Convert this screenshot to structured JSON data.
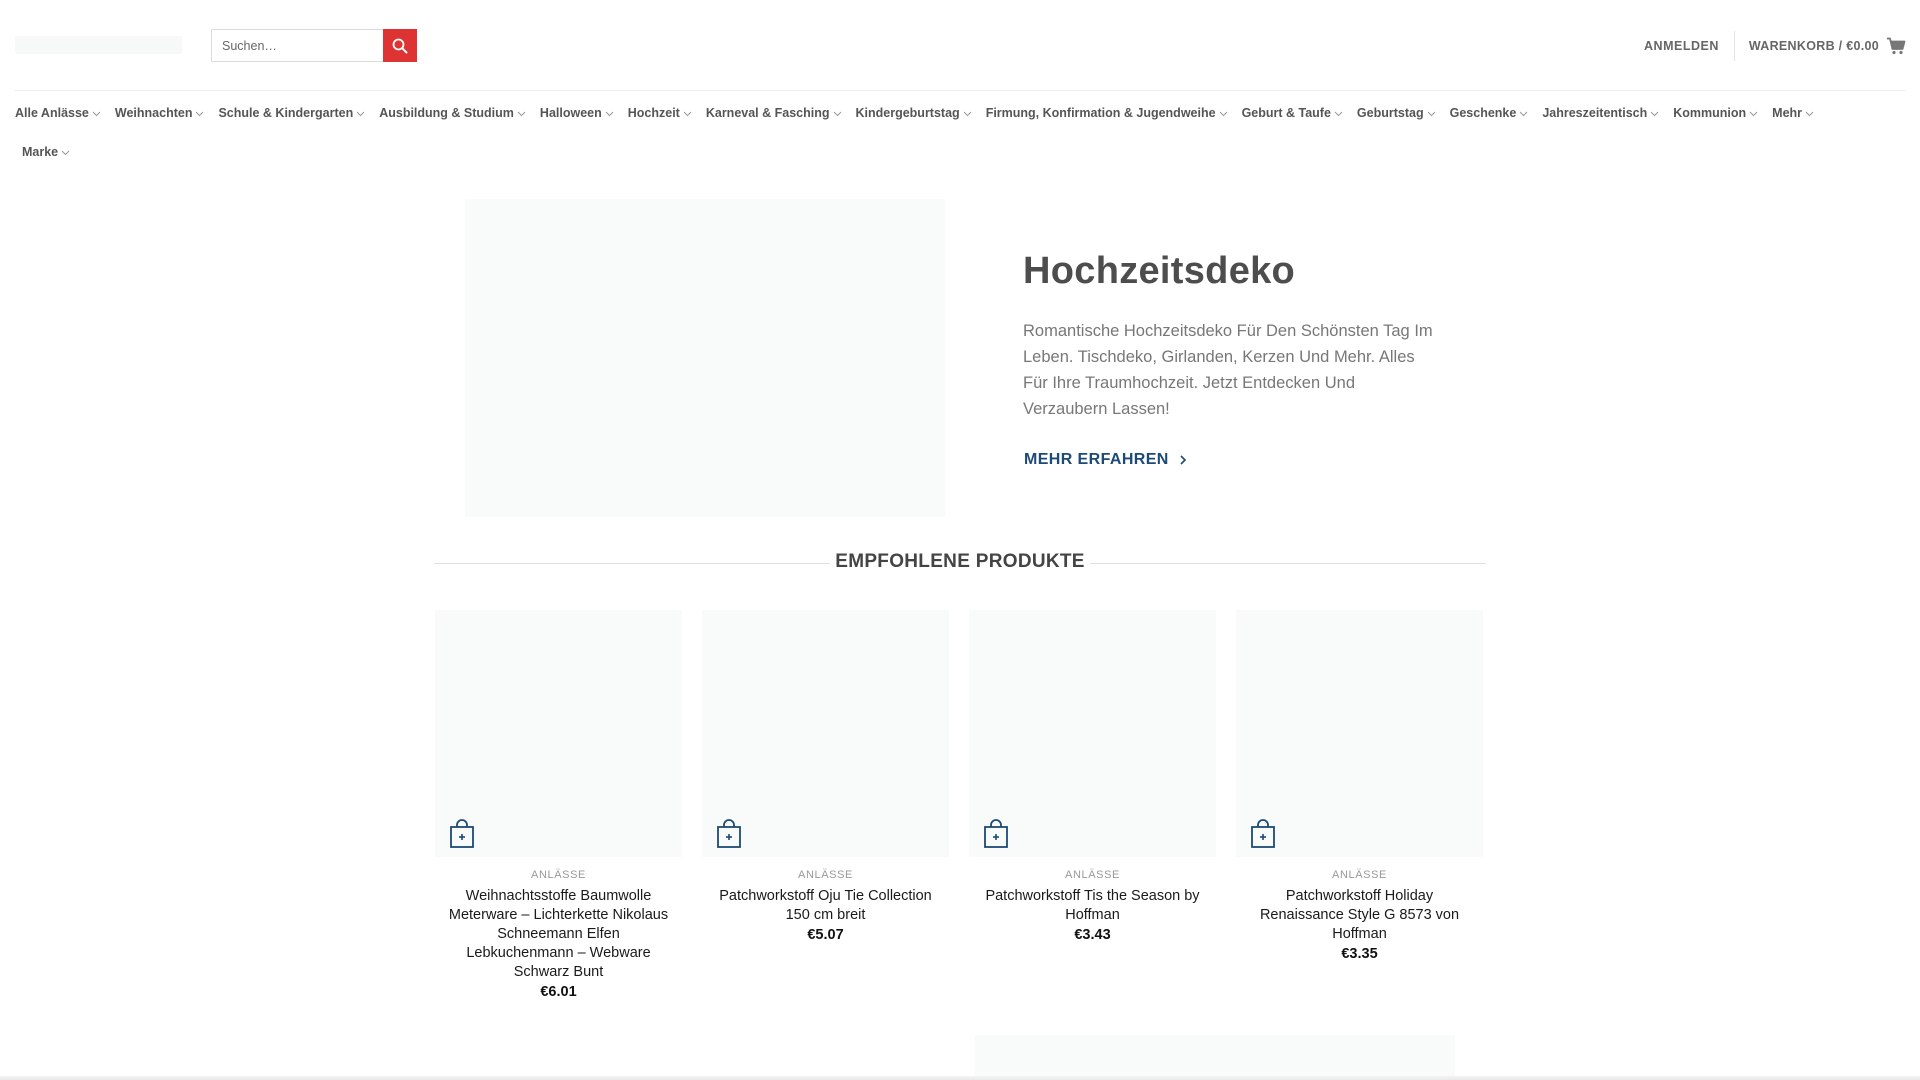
{
  "header": {
    "search_placeholder": "Suchen…",
    "login_label": "ANMELDEN",
    "cart_label": "WARENKORB / €0.00",
    "accent_color": "#dd3333"
  },
  "nav": {
    "items": [
      {
        "label": "Alle Anlässe"
      },
      {
        "label": "Weihnachten"
      },
      {
        "label": "Schule & Kindergarten"
      },
      {
        "label": "Ausbildung & Studium"
      },
      {
        "label": "Halloween"
      },
      {
        "label": "Hochzeit"
      },
      {
        "label": "Karneval & Fasching"
      },
      {
        "label": "Kindergeburtstag"
      },
      {
        "label": "Firmung, Konfirmation & Jugendweihe"
      },
      {
        "label": "Geburt & Taufe"
      },
      {
        "label": "Geburtstag"
      },
      {
        "label": "Geschenke"
      },
      {
        "label": "Jahreszeitentisch"
      },
      {
        "label": "Kommunion"
      },
      {
        "label": "Mehr"
      }
    ],
    "row2": [
      {
        "label": "Marke"
      }
    ]
  },
  "hero": {
    "title": "Hochzeitsdeko",
    "text": "Romantische Hochzeitsdeko Für Den Schönsten Tag Im Leben. Tischdeko, Girlanden, Kerzen Und Mehr. Alles Für Ihre Traumhochzeit. Jetzt Entdecken Und Verzaubern Lassen!",
    "cta_label": "MEHR ERFAHREN",
    "cta_color": "#1d4a76"
  },
  "featured": {
    "title": "EMPFOHLENE PRODUKTE",
    "products": [
      {
        "category": "ANLÄSSE",
        "title": "Weihnachtsstoffe Baumwolle Meterware – Lichterkette Nikolaus Schneemann Elfen Lebkuchenmann – Webware Schwarz Bunt",
        "price": "€6.01"
      },
      {
        "category": "ANLÄSSE",
        "title": "Patchworkstoff Oju Tie Collection 150 cm breit",
        "price": "€5.07"
      },
      {
        "category": "ANLÄSSE",
        "title": "Patchworkstoff Tis the Season by Hoffman",
        "price": "€3.43"
      },
      {
        "category": "ANLÄSSE",
        "title": "Patchworkstoff Holiday Renaissance Style G 8573 von Hoffman",
        "price": "€3.35"
      }
    ]
  },
  "icons": {
    "search": "search-icon",
    "cart": "cart-icon",
    "chevron": "chevron-down-icon",
    "cta_arrow": "chevron-right-icon",
    "bag": "add-to-cart-bag-icon"
  }
}
